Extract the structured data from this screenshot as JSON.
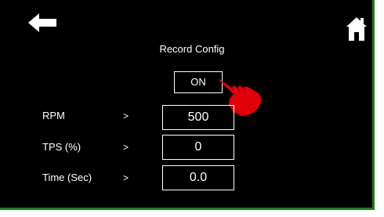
{
  "icons": {
    "back": "arrow-left-icon",
    "home": "home-icon",
    "pointer": "pointing-hand-icon"
  },
  "page": {
    "title": "Record Config"
  },
  "record_toggle": {
    "label": "ON"
  },
  "rows": [
    {
      "label": "RPM",
      "arrow": ">",
      "value": "500"
    },
    {
      "label": "TPS (%)",
      "arrow": ">",
      "value": "0"
    },
    {
      "label": "Time (Sec)",
      "arrow": ">",
      "value": "0.0"
    }
  ],
  "colors": {
    "background": "#000000",
    "foreground": "#ffffff",
    "border": "#1f7a1f",
    "pointer": "#e0000a"
  }
}
